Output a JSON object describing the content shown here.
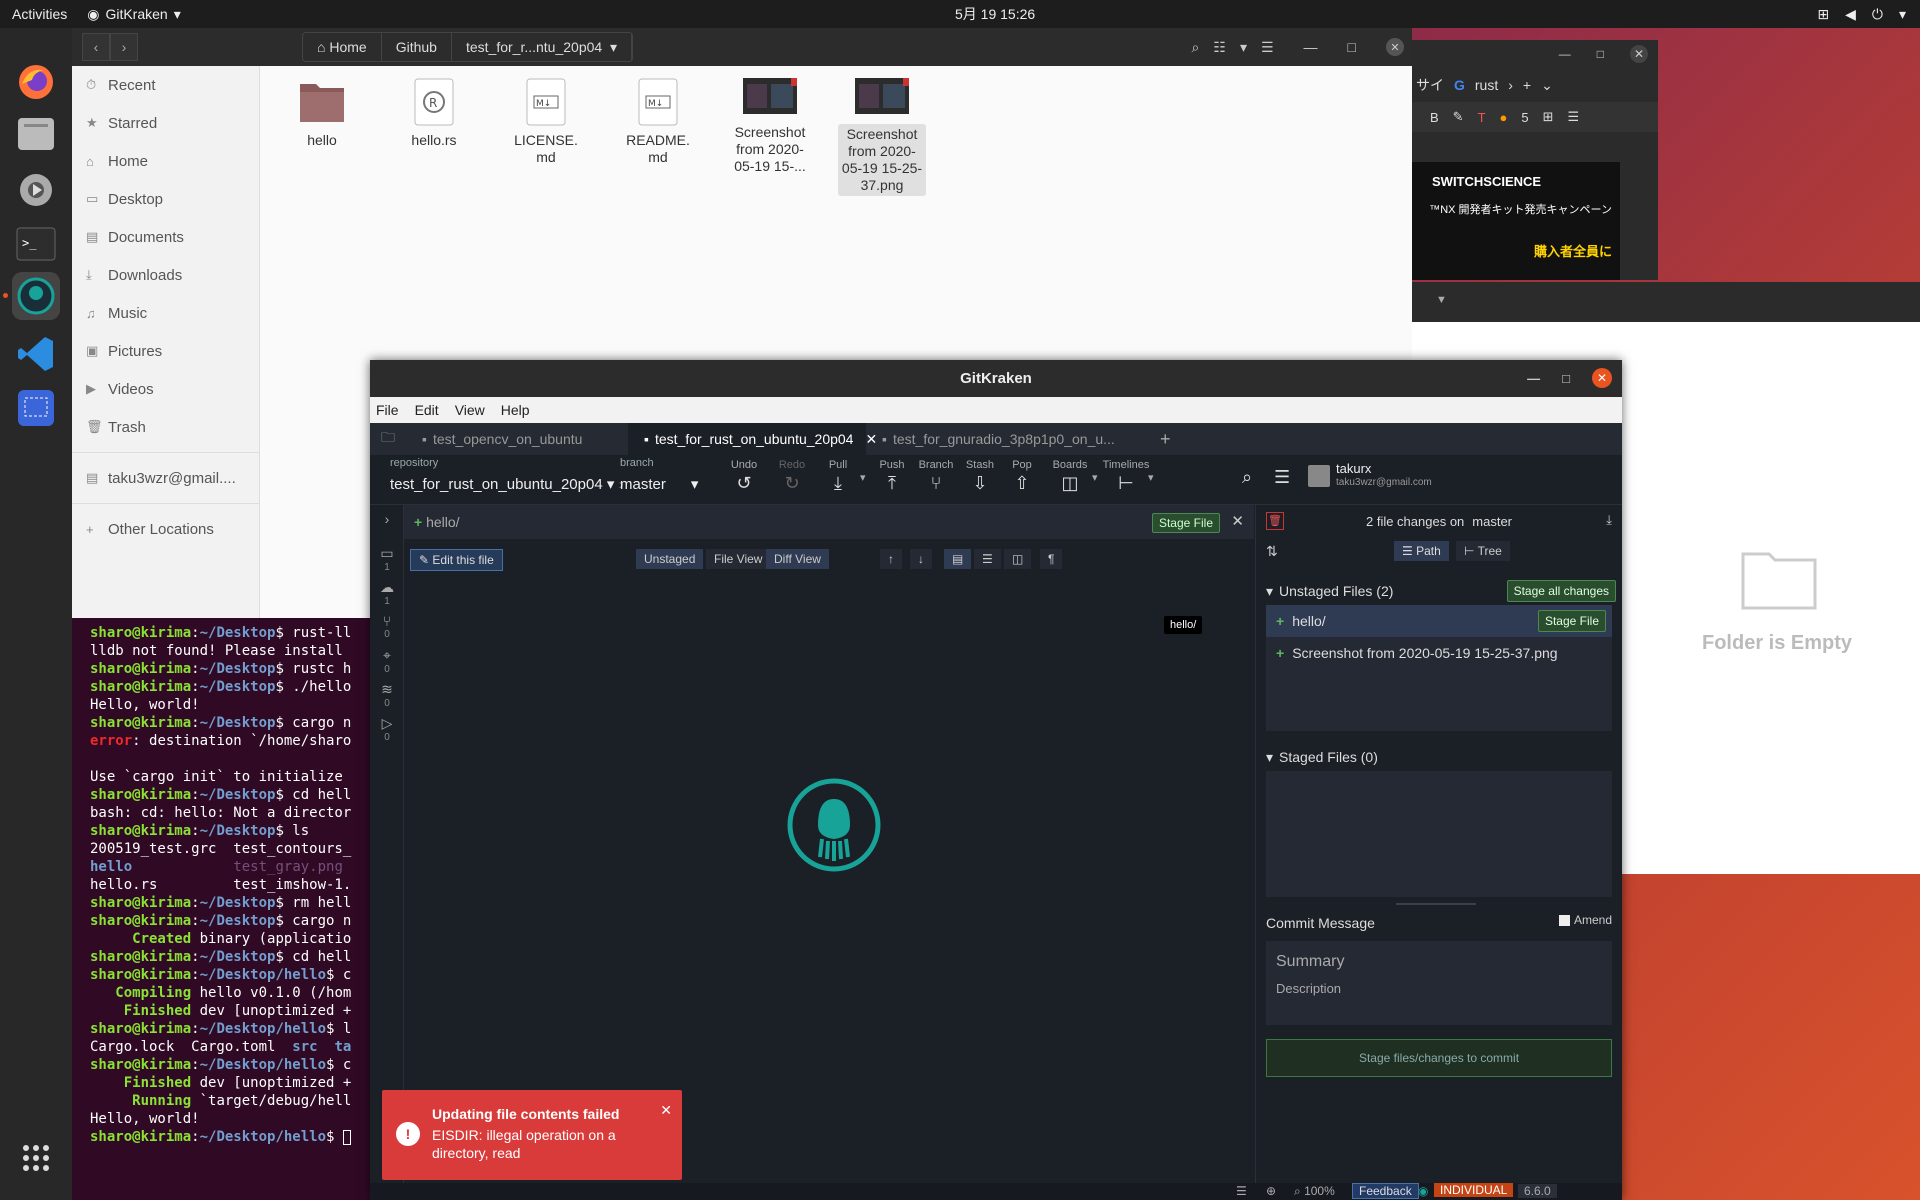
{
  "topbar": {
    "activities": "Activities",
    "app_name": "GitKraken",
    "clock": "5月 19 15:26"
  },
  "dock": {
    "icons": [
      "firefox-icon",
      "files-icon",
      "settings-icon",
      "terminal-icon",
      "gitkraken-icon",
      "vscode-icon",
      "screenshot-icon",
      "apps-grid-icon"
    ]
  },
  "files": {
    "breadcrumbs": [
      "Home",
      "Github",
      "test_for_r...ntu_20p04"
    ],
    "sidebar": [
      "Recent",
      "Starred",
      "Home",
      "Desktop",
      "Documents",
      "Downloads",
      "Music",
      "Pictures",
      "Videos",
      "Trash",
      "taku3wzr@gmail....",
      "Other Locations"
    ],
    "items": [
      {
        "name": "hello",
        "type": "folder"
      },
      {
        "name": "hello.rs",
        "type": "rust"
      },
      {
        "name": "LICENSE.\nmd",
        "type": "md"
      },
      {
        "name": "README.\nmd",
        "type": "md"
      },
      {
        "name": "Screenshot\nfrom 2020-\n05-19 15-...",
        "type": "image"
      },
      {
        "name": "Screenshot\nfrom 2020-\n05-19 15-25-\n37.png",
        "type": "image"
      }
    ]
  },
  "browser": {
    "tab_text": "rust",
    "tab_prefix": "サイ",
    "ad_brand": "SWITCHSCIENCE",
    "ad_line1": "™NX 開発者キット発売キャンペーン",
    "ad_line2": "購入者全員に"
  },
  "empty_folder": {
    "label": "Folder is Empty"
  },
  "terminal": {
    "lines": [
      [
        [
          "p",
          "sharo@kirima"
        ],
        [
          "t",
          ":"
        ],
        [
          "d",
          "~/Desktop"
        ],
        [
          "t",
          "$ rust-ll"
        ]
      ],
      [
        [
          "t",
          "lldb not found! Please install"
        ]
      ],
      [
        [
          "p",
          "sharo@kirima"
        ],
        [
          "t",
          ":"
        ],
        [
          "d",
          "~/Desktop"
        ],
        [
          "t",
          "$ rustc h"
        ]
      ],
      [
        [
          "p",
          "sharo@kirima"
        ],
        [
          "t",
          ":"
        ],
        [
          "d",
          "~/Desktop"
        ],
        [
          "t",
          "$ ./hello"
        ]
      ],
      [
        [
          "t",
          "Hello, world!"
        ]
      ],
      [
        [
          "p",
          "sharo@kirima"
        ],
        [
          "t",
          ":"
        ],
        [
          "d",
          "~/Desktop"
        ],
        [
          "t",
          "$ cargo n"
        ]
      ],
      [
        [
          "err",
          "error"
        ],
        [
          "t",
          ": destination `/home/sharo"
        ]
      ],
      [
        [
          "t",
          ""
        ]
      ],
      [
        [
          "t",
          "Use `cargo init` to initialize"
        ]
      ],
      [
        [
          "p",
          "sharo@kirima"
        ],
        [
          "t",
          ":"
        ],
        [
          "d",
          "~/Desktop"
        ],
        [
          "t",
          "$ cd hell"
        ]
      ],
      [
        [
          "t",
          "bash: cd: hello: Not a director"
        ]
      ],
      [
        [
          "p",
          "sharo@kirima"
        ],
        [
          "t",
          ":"
        ],
        [
          "d",
          "~/Desktop"
        ],
        [
          "t",
          "$ ls"
        ]
      ],
      [
        [
          "t",
          "200519_test.grc  test_contours_"
        ]
      ],
      [
        [
          "blu",
          "hello"
        ],
        [
          "t",
          "            "
        ],
        [
          "gry",
          "test_gray.png"
        ]
      ],
      [
        [
          "t",
          "hello.rs         test_imshow-1."
        ]
      ],
      [
        [
          "p",
          "sharo@kirima"
        ],
        [
          "t",
          ":"
        ],
        [
          "d",
          "~/Desktop"
        ],
        [
          "t",
          "$ rm hell"
        ]
      ],
      [
        [
          "p",
          "sharo@kirima"
        ],
        [
          "t",
          ":"
        ],
        [
          "d",
          "~/Desktop"
        ],
        [
          "t",
          "$ cargo n"
        ]
      ],
      [
        [
          "grn",
          "     Created"
        ],
        [
          "t",
          " binary (applicatio"
        ]
      ],
      [
        [
          "p",
          "sharo@kirima"
        ],
        [
          "t",
          ":"
        ],
        [
          "d",
          "~/Desktop"
        ],
        [
          "t",
          "$ cd hell"
        ]
      ],
      [
        [
          "p",
          "sharo@kirima"
        ],
        [
          "t",
          ":"
        ],
        [
          "d",
          "~/Desktop/hello"
        ],
        [
          "t",
          "$ c"
        ]
      ],
      [
        [
          "grn",
          "   Compiling"
        ],
        [
          "t",
          " hello v0.1.0 (/hom"
        ]
      ],
      [
        [
          "grn",
          "    Finished"
        ],
        [
          "t",
          " dev [unoptimized +"
        ]
      ],
      [
        [
          "p",
          "sharo@kirima"
        ],
        [
          "t",
          ":"
        ],
        [
          "d",
          "~/Desktop/hello"
        ],
        [
          "t",
          "$ l"
        ]
      ],
      [
        [
          "t",
          "Cargo.lock  Cargo.toml  "
        ],
        [
          "blu",
          "src  ta"
        ]
      ],
      [
        [
          "p",
          "sharo@kirima"
        ],
        [
          "t",
          ":"
        ],
        [
          "d",
          "~/Desktop/hello"
        ],
        [
          "t",
          "$ c"
        ]
      ],
      [
        [
          "grn",
          "    Finished"
        ],
        [
          "t",
          " dev [unoptimized +"
        ]
      ],
      [
        [
          "grn",
          "     Running"
        ],
        [
          "t",
          " `target/debug/hell"
        ]
      ],
      [
        [
          "t",
          "Hello, world!"
        ]
      ],
      [
        [
          "p",
          "sharo@kirima"
        ],
        [
          "t",
          ":"
        ],
        [
          "d",
          "~/Desktop/hello"
        ],
        [
          "t",
          "$ "
        ]
      ]
    ]
  },
  "gitkraken": {
    "title": "GitKraken",
    "menu": [
      "File",
      "Edit",
      "View",
      "Help"
    ],
    "tabs": [
      "test_opencv_on_ubuntu",
      "test_for_rust_on_ubuntu_20p04",
      "test_for_gnuradio_3p8p1p0_on_u..."
    ],
    "repo_label": "repository",
    "repo_name": "test_for_rust_on_ubuntu_20p04",
    "branch_label": "branch",
    "branch_name": "master",
    "toolbar": [
      "Undo",
      "Redo",
      "Pull",
      "Push",
      "Branch",
      "Stash",
      "Pop",
      "Boards",
      "Timelines"
    ],
    "user_name": "takurx",
    "user_email": "taku3wzr@gmail.com",
    "path": "hello/",
    "stage_file": "Stage File",
    "edit_file": "Edit this file",
    "view_unstaged": "Unstaged",
    "view_file": "File View",
    "view_diff": "Diff View",
    "rail_counts": [
      "1",
      "1",
      "0",
      "0",
      "0"
    ],
    "changes_head": "2 file changes on",
    "changes_branch": "master",
    "path_tab": "Path",
    "tree_tab": "Tree",
    "unstaged_title": "Unstaged Files (2)",
    "stage_all": "Stage all changes",
    "unstaged_files": [
      "hello/",
      "Screenshot from 2020-05-19 15-25-37.png"
    ],
    "tooltip": "hello/",
    "staged_title": "Staged Files (0)",
    "commit_title": "Commit Message",
    "amend": "Amend",
    "summary_ph": "Summary",
    "description_ph": "Description",
    "commit_btn": "Stage files/changes to commit",
    "status": {
      "zoom": "100%",
      "feedback": "Feedback",
      "plan": "INDIVIDUAL",
      "version": "6.6.0"
    }
  },
  "toast": {
    "title": "Updating file contents failed",
    "message": "EISDIR: illegal operation on a directory, read"
  }
}
